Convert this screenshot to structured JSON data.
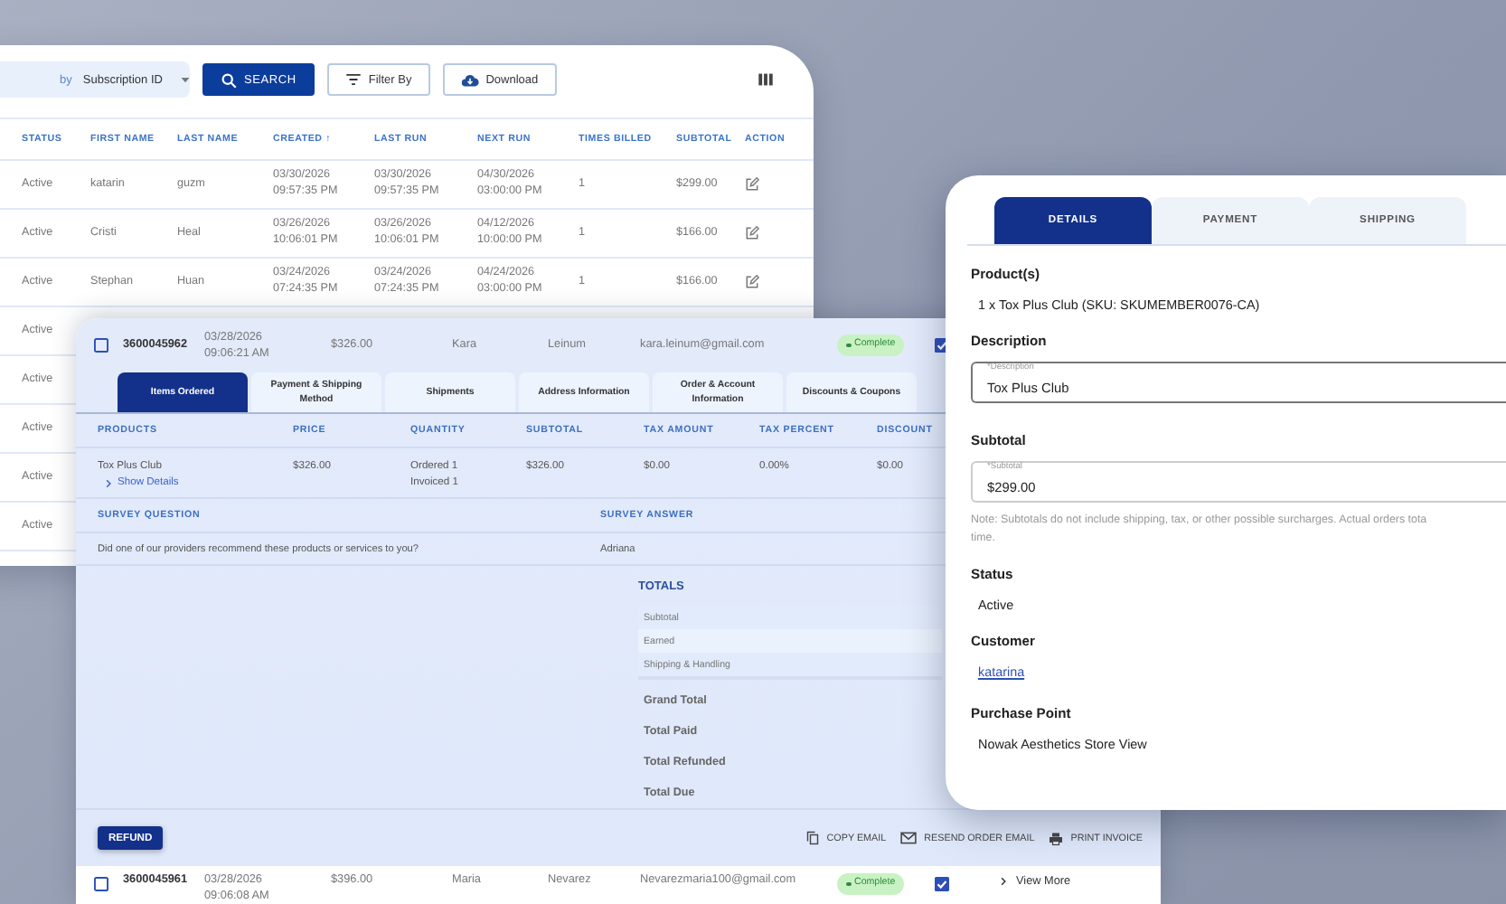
{
  "subscriptions_panel": {
    "search": {
      "by_label": "by",
      "field": "Subscription ID"
    },
    "buttons": [
      {
        "kind": "search",
        "label": "SEARCH"
      },
      {
        "kind": "filter",
        "label": "Filter By"
      },
      {
        "kind": "download",
        "label": "Download"
      }
    ],
    "columns": [
      {
        "label": "STATUS"
      },
      {
        "label": "FIRST NAME"
      },
      {
        "label": "LAST NAME"
      },
      {
        "label": "CREATED ↑"
      },
      {
        "label": "LAST RUN"
      },
      {
        "label": "NEXT RUN"
      },
      {
        "label": "TIMES BILLED"
      },
      {
        "label": "SUBTOTAL"
      },
      {
        "label": "ACTION"
      }
    ],
    "rows": [
      {
        "cells": [
          "Active",
          "katarin",
          "guzm",
          "03/30/2026\n09:57:35 PM",
          "03/30/2026\n09:57:35 PM",
          "04/30/2026\n03:00:00 PM",
          "1",
          "$299.00"
        ]
      },
      {
        "cells": [
          "Active",
          "Cristi",
          "Heal",
          "03/26/2026\n10:06:01 PM",
          "03/26/2026\n10:06:01 PM",
          "04/12/2026\n10:00:00 PM",
          "1",
          "$166.00"
        ]
      },
      {
        "cells": [
          "Active",
          "Stephan",
          "Huan",
          "03/24/2026\n07:24:35 PM",
          "03/24/2026\n07:24:35 PM",
          "04/24/2026\n03:00:00 PM",
          "1",
          "$166.00"
        ]
      },
      {
        "cells": [
          "Active"
        ]
      },
      {
        "cells": [
          "Active"
        ]
      },
      {
        "cells": [
          "Active"
        ]
      },
      {
        "cells": [
          "Active"
        ]
      },
      {
        "cells": [
          "Active"
        ]
      }
    ]
  },
  "order_panel": {
    "order": {
      "checked": false,
      "order_id": "3600045962",
      "date": "03/28/2026\n09:06:21 AM",
      "total": "$326.00",
      "first_name": "Kara",
      "last_name": "Leinum",
      "email": "kara.leinum@gmail.com",
      "status": "Complete",
      "second_checked": true
    },
    "tabs": [
      {
        "label": "Items Ordered",
        "selected": true
      },
      {
        "label": "Payment & Shipping Method",
        "selected": false
      },
      {
        "label": "Shipments",
        "selected": false
      },
      {
        "label": "Address Information",
        "selected": false
      },
      {
        "label": "Order & Account Information",
        "selected": false
      },
      {
        "label": "Discounts & Coupons",
        "selected": false
      }
    ],
    "products": {
      "columns": [
        "PRODUCTS",
        "PRICE",
        "QUANTITY",
        "SUBTOTAL",
        "TAX AMOUNT",
        "TAX PERCENT",
        "DISCOUNT"
      ],
      "rows": [
        {
          "link": "Show Details",
          "cells": [
            "Tox Plus Club",
            "$326.00",
            "Ordered 1\nInvoiced 1",
            "$326.00",
            "$0.00",
            "0.00%",
            "$0.00"
          ]
        }
      ]
    },
    "survey": {
      "question_heading": "SURVEY QUESTION",
      "answer_heading": "SURVEY ANSWER",
      "question": "Did one of our providers recommend these products or services to you?",
      "answer": "Adriana"
    },
    "totals": {
      "title": "TOTALS",
      "lines": [
        "Subtotal",
        "Earned",
        "Shipping & Handling"
      ],
      "summary": [
        "Grand Total",
        "Total Paid",
        "Total Refunded",
        "Total Due"
      ]
    },
    "refund_button": "REFUND",
    "actions": [
      {
        "kind": "copy",
        "label": "COPY EMAIL"
      },
      {
        "kind": "mail",
        "label": "RESEND ORDER EMAIL"
      },
      {
        "kind": "print",
        "label": "PRINT INVOICE"
      }
    ],
    "next_order": {
      "checked": false,
      "order_id": "3600045961",
      "date": "03/28/2026\n09:06:08 AM",
      "total": "$396.00",
      "first_name": "Maria",
      "last_name": "Nevarez",
      "email": "Nevarezmaria100@gmail.com",
      "status": "Complete",
      "second_checked": true,
      "link": "View More"
    }
  },
  "details_panel": {
    "tabs": [
      {
        "label": "DETAILS",
        "selected": true
      },
      {
        "label": "PAYMENT",
        "selected": false
      },
      {
        "label": "SHIPPING",
        "selected": false
      }
    ],
    "sections": [
      {
        "kind": "text",
        "heading": "Product(s)",
        "value": "1 x Tox Plus Club (SKU: SKUMEMBER0076-CA)"
      },
      {
        "kind": "field",
        "heading": "Description",
        "label": "*Description",
        "value": "Tox Plus Club"
      },
      {
        "kind": "field",
        "heading": "Subtotal",
        "label": "*Subtotal",
        "value": "$299.00",
        "note_lines": [
          "Note: Subtotals do not include shipping, tax, or other possible surcharges. Actual orders tota",
          "time."
        ]
      },
      {
        "kind": "text",
        "heading": "Status",
        "value": "Active"
      },
      {
        "kind": "link",
        "heading": "Customer",
        "value": "katarina"
      },
      {
        "kind": "text",
        "heading": "Purchase Point",
        "value": "Nowak Aesthetics Store View"
      }
    ]
  }
}
